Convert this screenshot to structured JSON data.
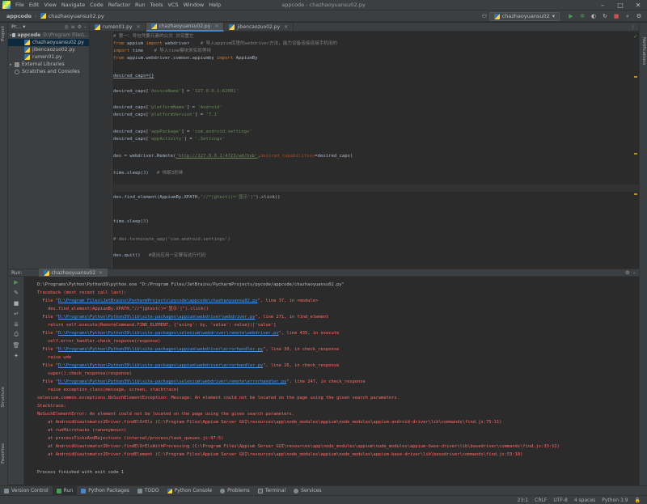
{
  "title_bar": {
    "menus": [
      "File",
      "Edit",
      "View",
      "Navigate",
      "Code",
      "Refactor",
      "Run",
      "Tools",
      "VCS",
      "Window",
      "Help"
    ],
    "window_title": "appcode - chazhaoyuansu02.py"
  },
  "nav": {
    "project": "appcode",
    "file": "chazhaoyuansu02.py",
    "run_config": "chazhaoyuansu02"
  },
  "project_panel": {
    "header": "Pr...",
    "root": "appcode",
    "root_path": "D:\\Program Files\\...",
    "files": [
      "chazhaoyuansu02.py",
      "jibencaozuo02.py",
      "rumen01.py"
    ],
    "external": "External Libraries",
    "scratches": "Scratches and Consoles"
  },
  "left_stripe": {
    "project": "Project",
    "structure": "Structure",
    "favorites": "Favorites"
  },
  "right_stripe": {
    "notifications": "Notifications"
  },
  "editor": {
    "tabs": [
      "rumen01.py",
      "chazhaoyuansu02.py",
      "jibencaozuo02.py"
    ],
    "active_tab": 1,
    "lines": {
      "l1": "# 第一：导包凭要元素的公共 并设置它",
      "l2_kw": "from",
      "l2_mod": " appium ",
      "l2_kw2": "import",
      "l2_rest": " webdriver",
      "l2_cmt": "    # 导入appium库里的webdriver方法，能力设备连接连接手机用的",
      "l3_kw": "import",
      "l3_rest": " time",
      "l3_cmt": "    # 导入time模块来实现等待",
      "l4_kw": "from",
      "l4_mod": " appium.webdriver.common.appiumby ",
      "l4_kw2": "import",
      "l4_rest": " AppiumBy",
      "l5": "desired_caps={}",
      "l6_a": "desired_caps[",
      "l6_k": "'deviceName'",
      "l6_b": "] = ",
      "l6_v": "'127.0.0.1:62001'",
      "l7_a": "desired_caps[",
      "l7_k": "'platformName'",
      "l7_b": "] = ",
      "l7_v": "'Android'",
      "l8_a": "desired_caps[",
      "l8_k": "'platformVersion'",
      "l8_b": "] = ",
      "l8_v": "'7.1'",
      "l9_a": "desired_caps[",
      "l9_k": "'appPackage'",
      "l9_b": "] = ",
      "l9_v": "'com.android.settings'",
      "l10_a": "desired_caps[",
      "l10_k": "'appActivity'",
      "l10_b": "] = ",
      "l10_v": "'.Settings'",
      "l11_a": "des = webdriver.Remote(",
      "l11_url": "'http://127.0.0.1:4723/wd/hub'",
      "l11_b": ",",
      "l11_kw": "desired_capabilities",
      "l11_c": "=desired_caps)",
      "l12_a": "time.sleep(",
      "l12_n": "3",
      "l12_b": ")",
      "l12_cmt": "   # 休眠3秒钟",
      "l13_a": "des.find_element(AppiumBy.XPATH,",
      "l13_s": "\"//*[@text()='显示']\"",
      "l13_b": ").click()",
      "l14_a": "time.sleep(",
      "l14_n": "3",
      "l14_b": ")",
      "l15": "# des.terminate_app('com.android.settings')",
      "l16_a": "des.quit()",
      "l16_cmt": "   #退出应用一定要有这行代码"
    }
  },
  "run": {
    "label": "Run:",
    "tab": "chazhaoyuansu02",
    "console": {
      "c0": "D:\\Programs\\Python\\Python39\\python.exe \"D:/Program Files/JetBrains/PycharmProjects/pycode/appcode/chazhaoyuansu02.py\"",
      "c1": "Traceback (most recent call last):",
      "c2_a": "  File \"",
      "c2_l": "D:\\Program Files\\JetBrains\\PycharmProjects\\pycode\\appcode\\chazhaoyuansu02.py",
      "c2_b": "\", line 37, in <module>",
      "c3": "    des.find_element(AppiumBy.XPATH,\"//*[@text()='显示']\").click()",
      "c4_a": "  File \"",
      "c4_l": "D:\\Programs\\Python\\Python39\\lib\\site-packages\\appium\\webdriver\\webdriver.py",
      "c4_b": "\", line 271, in find_element",
      "c5": "    return self.execute(RemoteCommand.FIND_ELEMENT, {'using': by, 'value': value})['value']",
      "c6_a": "  File \"",
      "c6_l": "D:\\Programs\\Python\\Python39\\lib\\site-packages\\selenium\\webdriver\\remote\\webdriver.py",
      "c6_b": "\", line 435, in execute",
      "c7": "    self.error_handler.check_response(response)",
      "c8_a": "  File \"",
      "c8_l": "D:\\Programs\\Python\\Python39\\lib\\site-packages\\appium\\webdriver\\errorhandler.py",
      "c8_b": "\", line 30, in check_response",
      "c9": "    raise wde",
      "c10_a": "  File \"",
      "c10_l": "D:\\Programs\\Python\\Python39\\lib\\site-packages\\appium\\webdriver\\errorhandler.py",
      "c10_b": "\", line 26, in check_response",
      "c11": "    super().check_response(response)",
      "c12_a": "  File \"",
      "c12_l": "D:\\Programs\\Python\\Python39\\lib\\site-packages\\selenium\\webdriver\\remote\\errorhandler.py",
      "c12_b": "\", line 247, in check_response",
      "c13": "    raise exception_class(message, screen, stacktrace)",
      "c14": "selenium.common.exceptions.NoSuchElementException: Message: An element could not be located on the page using the given search parameters.",
      "c15": "Stacktrace:",
      "c16": "NoSuchElementError: An element could not be located on the page using the given search parameters.",
      "c17": "    at AndroidUiautomator2Driver.findElOrEls (C:\\Program Files\\Appium Server GUI\\resources\\app\\node_modules\\appium\\node_modules\\appium-android-driver\\lib\\commands\\find.js:75:11)",
      "c18": "    at runMicrotasks (<anonymous>)",
      "c19": "    at processTicksAndRejections (internal/process/task_queues.js:97:5)",
      "c20": "    at AndroidUiautomator2Driver.findElOrElsWithProcessing (C:\\Program Files\\Appium Server GUI\\resources\\app\\node_modules\\appium\\node_modules\\appium-base-driver\\lib\\basedriver\\commands\\find.js:33:12)",
      "c21": "    at AndroidUiautomator2Driver.findElement (C:\\Program Files\\Appium Server GUI\\resources\\app\\node_modules\\appium\\node_modules\\appium-base-driver\\lib\\basedriver\\commands\\find.js:53:10)",
      "c22": "Process finished with exit code 1"
    }
  },
  "bottom_tabs": [
    "Version Control",
    "Run",
    "Python Packages",
    "TODO",
    "Python Console",
    "Problems",
    "Terminal",
    "Services"
  ],
  "status": {
    "position": "23:1",
    "line_sep": "CRLF",
    "encoding": "UTF-8",
    "indent": "4 spaces",
    "interpreter": "Python 3.9"
  }
}
